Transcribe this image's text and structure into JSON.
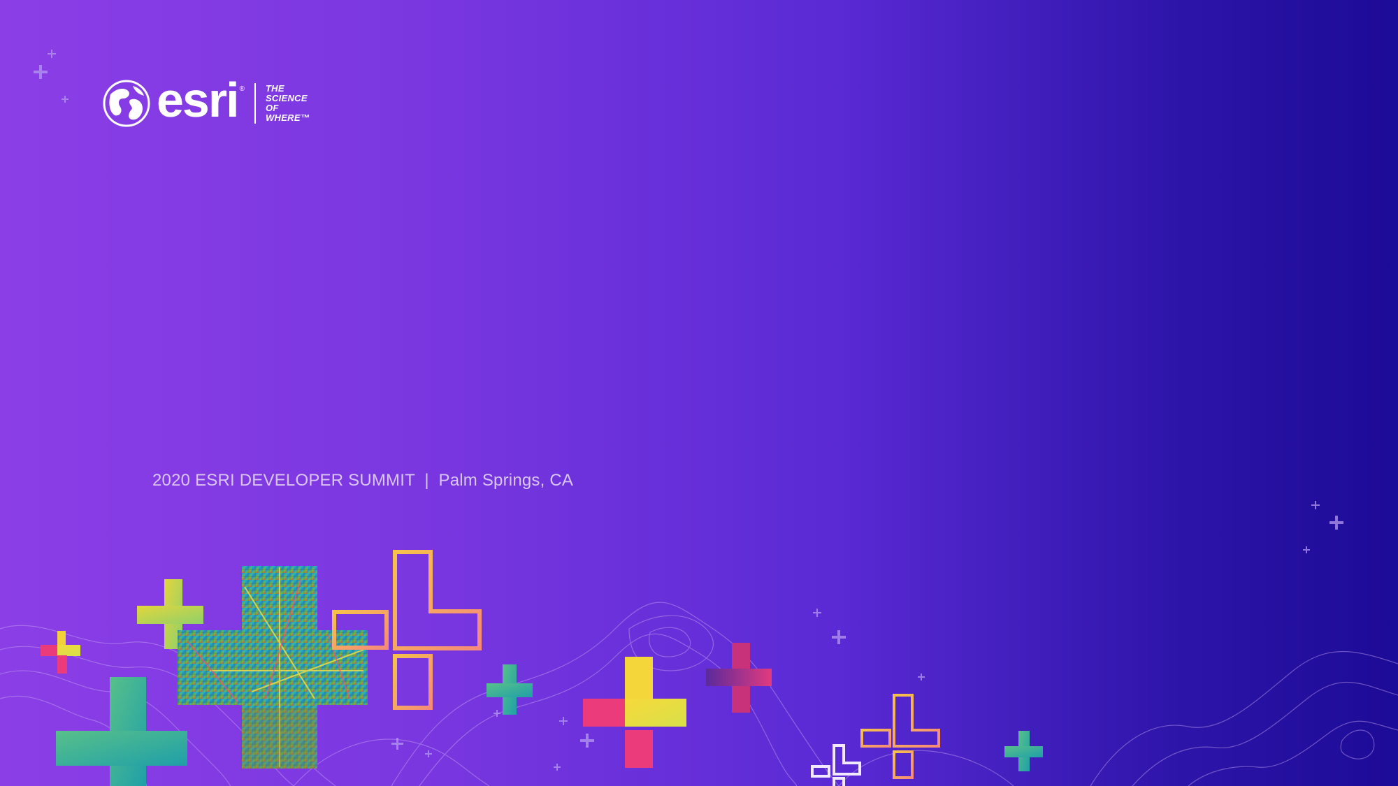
{
  "logo": {
    "wordmark": "esri",
    "registered": "®",
    "tagline": [
      "THE",
      "SCIENCE",
      "OF",
      "WHERE™"
    ]
  },
  "footer": {
    "event": "2020 ESRI DEVELOPER SUMMIT",
    "separator": "|",
    "location": "Palm Springs, CA"
  },
  "colors": {
    "background_start": "#8b3ee6",
    "background_end": "#1c0b97",
    "footer_text": "#d9c6f2",
    "accent_yellow": "#f4d63a",
    "accent_pink": "#ec3b7a",
    "accent_teal": "#2fb3a0",
    "accent_orange": "#f7a14a"
  }
}
